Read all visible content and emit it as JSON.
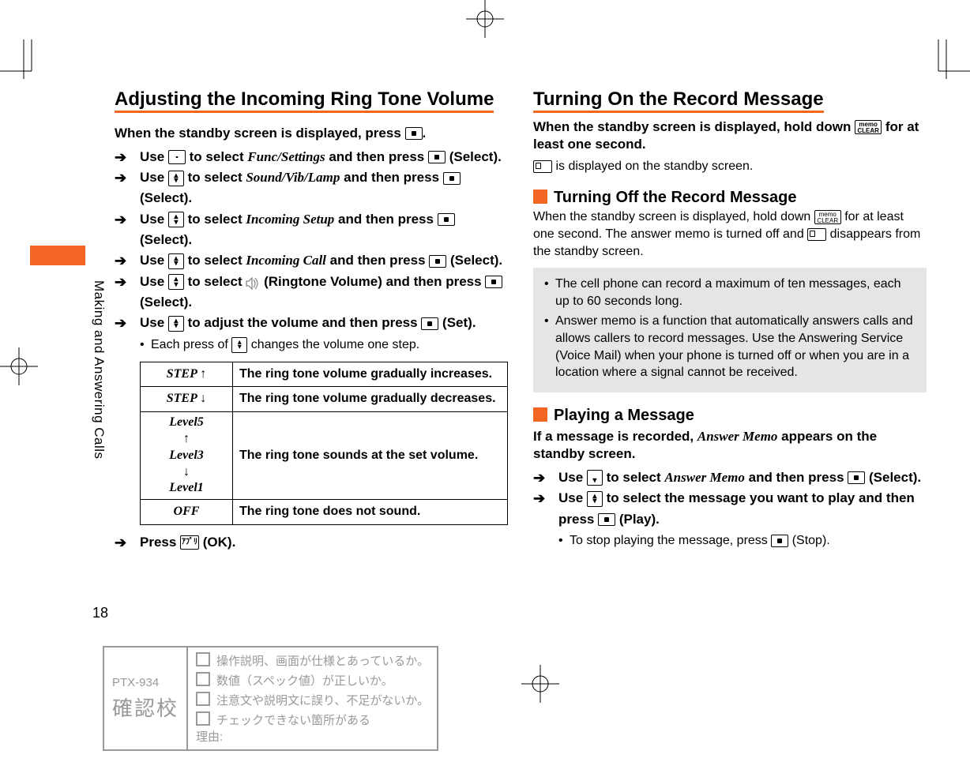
{
  "page_number": "18",
  "side_label": "Making and Answering Calls",
  "left": {
    "heading": "Adjusting the Incoming Ring Tone Volume",
    "lead_prefix": "When the standby screen is displayed, press ",
    "lead_suffix": ".",
    "steps": [
      {
        "pre": "Use ",
        "key": "nav4",
        "post_a": " to select ",
        "menu": "Func/Settings",
        "post_b": " and then press ",
        "key2": "center",
        "post_c": " (Select)."
      },
      {
        "pre": "Use ",
        "key": "navud",
        "post_a": " to select ",
        "menu": "Sound/Vib/Lamp",
        "post_b": " and then press ",
        "key2": "center",
        "post_c": " (Select)."
      },
      {
        "pre": "Use ",
        "key": "navud",
        "post_a": " to select ",
        "menu": "Incoming Setup",
        "post_b": " and then press ",
        "key2": "center",
        "post_c": " (Select)."
      },
      {
        "pre": "Use ",
        "key": "navud",
        "post_a": " to select ",
        "menu": "Incoming Call",
        "post_b": " and then press ",
        "key2": "center",
        "post_c": " (Select)."
      },
      {
        "pre": "Use ",
        "key": "navud",
        "post_a": " to select ",
        "icon": "speaker",
        "post_icon": " (Ringtone Volume) and then press ",
        "key2": "center",
        "post_c": " (Select)."
      },
      {
        "pre": "Use ",
        "key": "navud",
        "post_a": " to adjust the volume and then press ",
        "key2": "center",
        "post_c": " (Set).",
        "note_pre": "Each press of ",
        "note_key": "navud",
        "note_post": " changes the volume one step."
      }
    ],
    "table": [
      {
        "label": "STEP ↑",
        "desc": "The ring tone volume gradually increases."
      },
      {
        "label": "STEP ↓",
        "desc": "The ring tone volume gradually decreases."
      },
      {
        "label": "Level5\n↑\nLevel3\n↓\nLevel1",
        "desc": "The ring tone sounds at the set volume.",
        "tall": true
      },
      {
        "label": "OFF",
        "desc": "The ring tone does not sound."
      }
    ],
    "press_ok_pre": "Press ",
    "press_ok_key_label": "ｱﾌﾟﾘ",
    "press_ok_post": " (OK)."
  },
  "right": {
    "heading": "Turning On the Record Message",
    "lead_pre": "When the standby screen is displayed, hold down ",
    "lead_key_label": "memo\nCLEAR",
    "lead_post": " for at least one second.",
    "lead2_post": " is displayed on the standby screen.",
    "off_heading": "Turning Off the Record Message",
    "off_pre": "When the standby screen is displayed, hold down ",
    "off_mid": " for at least one second. The answer memo is turned off and ",
    "off_post": " disappears from the standby screen.",
    "notes": [
      "The cell phone can record a maximum of ten messages, each up to 60 seconds long.",
      "Answer memo is a function that automatically answers calls and allows callers to record messages. Use the Answering Service (Voice Mail) when your phone is turned off or when you are in a location where a signal cannot be received."
    ],
    "play_heading": "Playing a Message",
    "play_lead_pre": "If a message is recorded, ",
    "play_lead_menu": "Answer Memo",
    "play_lead_post": " appears on the standby screen.",
    "play_steps": [
      {
        "pre": "Use ",
        "key": "navd",
        "post_a": " to select ",
        "menu": "Answer Memo",
        "post_b": " and then press ",
        "key2": "center",
        "post_c": " (Select)."
      },
      {
        "pre": "Use ",
        "key": "navud",
        "post_a": " to select the message you want to play and then press ",
        "key2": "center",
        "post_c": " (Play).",
        "note_pre": "To stop playing the message, press ",
        "note_key": "center",
        "note_post": " (Stop)."
      }
    ]
  },
  "proof": {
    "code": "PTX-934",
    "label": "確認校",
    "items": [
      "操作説明、画面が仕様とあっているか。",
      "数値（スペック値）が正しいか。",
      "注意文や説明文に誤り、不足がないか。",
      "チェックできない箇所がある\n理由:"
    ]
  }
}
